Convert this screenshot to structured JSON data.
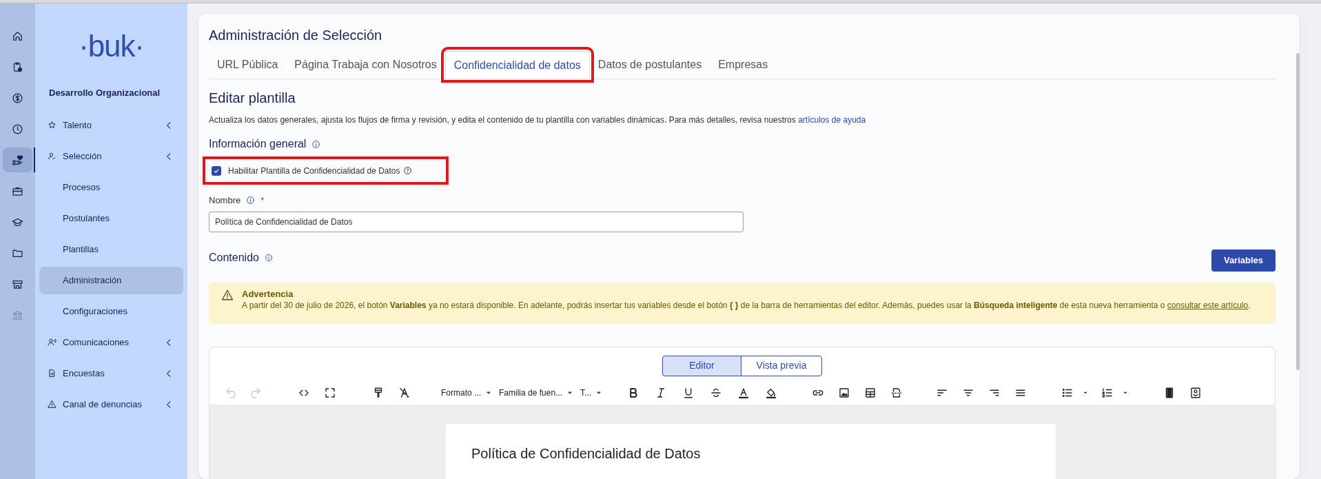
{
  "rail": [
    {
      "selected": false,
      "disabled": false
    },
    {
      "selected": false,
      "disabled": false
    },
    {
      "selected": false,
      "disabled": false
    },
    {
      "selected": false,
      "disabled": false
    },
    {
      "selected": true,
      "disabled": false
    },
    {
      "selected": false,
      "disabled": false
    },
    {
      "selected": false,
      "disabled": false
    },
    {
      "selected": false,
      "disabled": false
    },
    {
      "selected": false,
      "disabled": false
    },
    {
      "selected": false,
      "disabled": true
    }
  ],
  "sidebar": {
    "logo": "·buk·",
    "section": "Desarrollo Organizacional",
    "items": [
      {
        "kind": "group",
        "label": "Talento",
        "selected": false
      },
      {
        "kind": "group",
        "label": "Selección",
        "selected": false
      },
      {
        "kind": "child",
        "label": "Procesos",
        "selected": false
      },
      {
        "kind": "child",
        "label": "Postulantes",
        "selected": false
      },
      {
        "kind": "child",
        "label": "Plantillas",
        "selected": false
      },
      {
        "kind": "child",
        "label": "Administración",
        "selected": true
      },
      {
        "kind": "child",
        "label": "Configuraciones",
        "selected": false
      },
      {
        "kind": "group",
        "label": "Comunicaciones",
        "selected": false
      },
      {
        "kind": "group",
        "label": "Encuestas",
        "selected": false
      },
      {
        "kind": "group",
        "label": "Canal de denuncias",
        "selected": false
      }
    ]
  },
  "page": {
    "title": "Administración de Selección"
  },
  "tabs": [
    {
      "label": "URL Pública",
      "selected": false,
      "highlighted": false
    },
    {
      "label": "Página Trabaja con Nosotros",
      "selected": false,
      "highlighted": false
    },
    {
      "label": "Confidencialidad de datos",
      "selected": true,
      "highlighted": true
    },
    {
      "label": "Datos de postulantes",
      "selected": false,
      "highlighted": false
    },
    {
      "label": "Empresas",
      "selected": false,
      "highlighted": false
    }
  ],
  "form": {
    "heading": "Editar plantilla",
    "description": "Actualiza los datos generales, ajusta los flujos de firma y revisión, y edita el contenido de tu plantilla con variables dinámicas. Para más detalles, revisa nuestros",
    "description_link": "artículos de ayuda",
    "general_heading": "Información general",
    "enable_checkbox": {
      "label": "Habilitar Plantilla de Confidencialidad de Datos",
      "checked": true,
      "highlighted": true
    },
    "name_label": "Nombre",
    "required_mark": "*",
    "name_value": "Política de Confidencialidad de Datos",
    "content_heading": "Contenido",
    "variables_button": "Variables"
  },
  "warning": {
    "title": "Advertencia",
    "text": "A partir del 30 de julio de 2026, el botón **Variables** ya no estará disponible. En adelante, podrás insertar tus variables desde el botón **{ }** de la barra de herramientas del editor. Además, puedes usar la **Búsqueda inteligente** de esta nueva herramienta o",
    "link": "consultar este artículo",
    "after": "."
  },
  "editor": {
    "modes": [
      {
        "label": "Editor",
        "selected": true
      },
      {
        "label": "Vista previa",
        "selected": false
      }
    ],
    "history_disabled": true,
    "dropdowns": [
      "Formato ...",
      "Familia de fuen...",
      "T..."
    ],
    "document_title": "Política de Confidencialidad de Datos"
  }
}
